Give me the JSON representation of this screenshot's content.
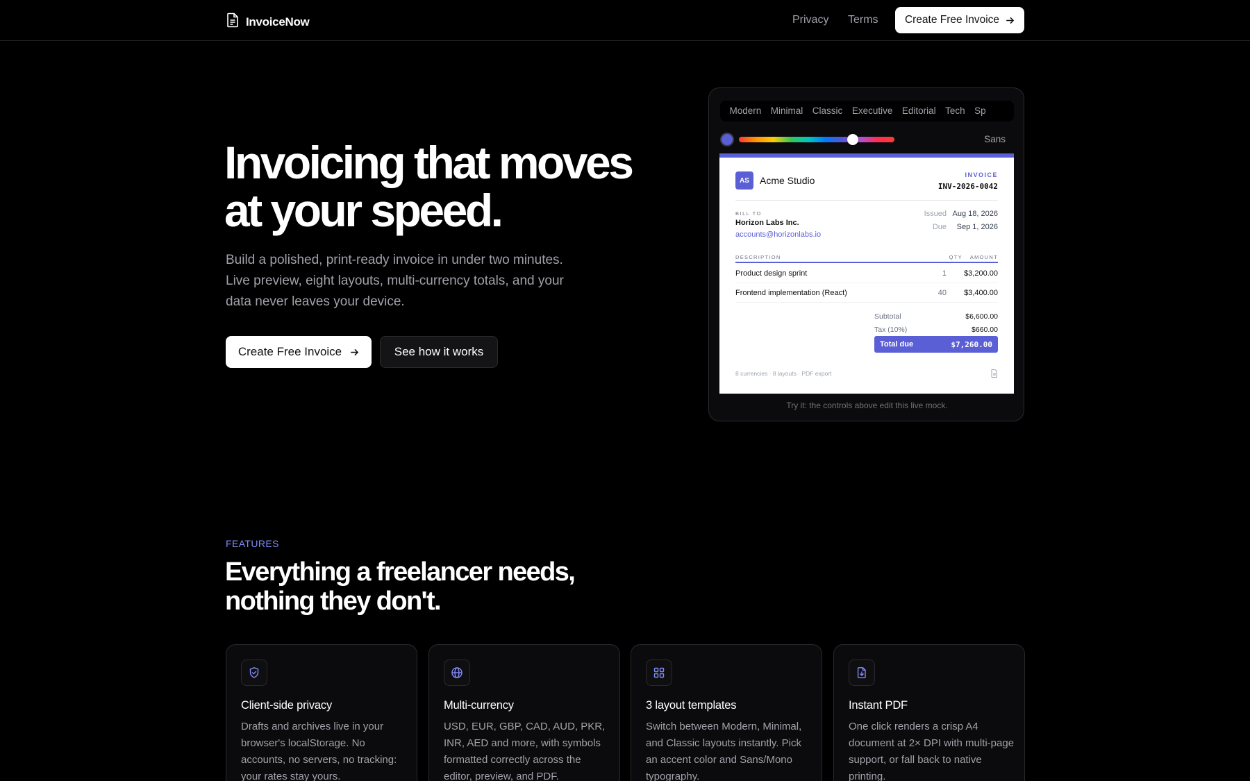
{
  "nav": {
    "brand": "InvoiceNow",
    "links": [
      "Privacy",
      "Terms"
    ],
    "cta": "Create Free Invoice"
  },
  "hero": {
    "title": "Invoicing that moves at your speed.",
    "subtitle": "Build a polished, print-ready invoice in under two minutes. Live preview, eight layouts, multi-currency totals, and your data never leaves your device.",
    "primary_cta": "Create Free Invoice",
    "secondary_cta": "See how it works"
  },
  "mock": {
    "tabs": [
      "Modern",
      "Minimal",
      "Classic",
      "Executive",
      "Editorial",
      "Tech",
      "Sp"
    ],
    "font_toggle": "Sans",
    "accent_color": "#5b5fd6",
    "hue_value_fraction": 0.73,
    "invoice": {
      "logo": "AS",
      "company": "Acme Studio",
      "label": "INVOICE",
      "number": "INV-2026-0042",
      "bill_to_label": "BILL TO",
      "client": "Horizon Labs Inc.",
      "client_email": "accounts@horizonlabs.io",
      "issued_label": "Issued",
      "issued": "Aug 18, 2026",
      "due_label": "Due",
      "due": "Sep 1, 2026",
      "columns": [
        "DESCRIPTION",
        "QTY",
        "AMOUNT"
      ],
      "items": [
        {
          "description": "Product design sprint",
          "qty": "1",
          "amount": "$3,200.00"
        },
        {
          "description": "Frontend implementation (React)",
          "qty": "40",
          "amount": "$3,400.00"
        }
      ],
      "subtotal_label": "Subtotal",
      "subtotal": "$6,600.00",
      "tax_label": "Tax (10%)",
      "tax": "$660.00",
      "total_label": "Total due",
      "total": "$7,260.00",
      "footnote": "8 currencies · 8 layouts · PDF export"
    },
    "hint": "Try it: the controls above edit this live mock."
  },
  "features": {
    "eyebrow": "FEATURES",
    "title": "Everything a freelancer needs, nothing they don't.",
    "cards": [
      {
        "icon": "shield-check-icon",
        "title": "Client-side privacy",
        "desc": "Drafts and archives live in your browser's localStorage. No accounts, no servers, no tracking: your rates stay yours."
      },
      {
        "icon": "globe-icon",
        "title": "Multi-currency",
        "desc": "USD, EUR, GBP, CAD, AUD, PKR, INR, AED and more, with symbols formatted correctly across the editor, preview, and PDF."
      },
      {
        "icon": "grid-icon",
        "title": "3 layout templates",
        "desc": "Switch between Modern, Minimal, and Classic layouts instantly. Pick an accent color and Sans/Mono typography."
      },
      {
        "icon": "file-download-icon",
        "title": "Instant PDF",
        "desc": "One click renders a crisp A4 document at 2× DPI with multi-page support, or fall back to native printing."
      }
    ]
  }
}
